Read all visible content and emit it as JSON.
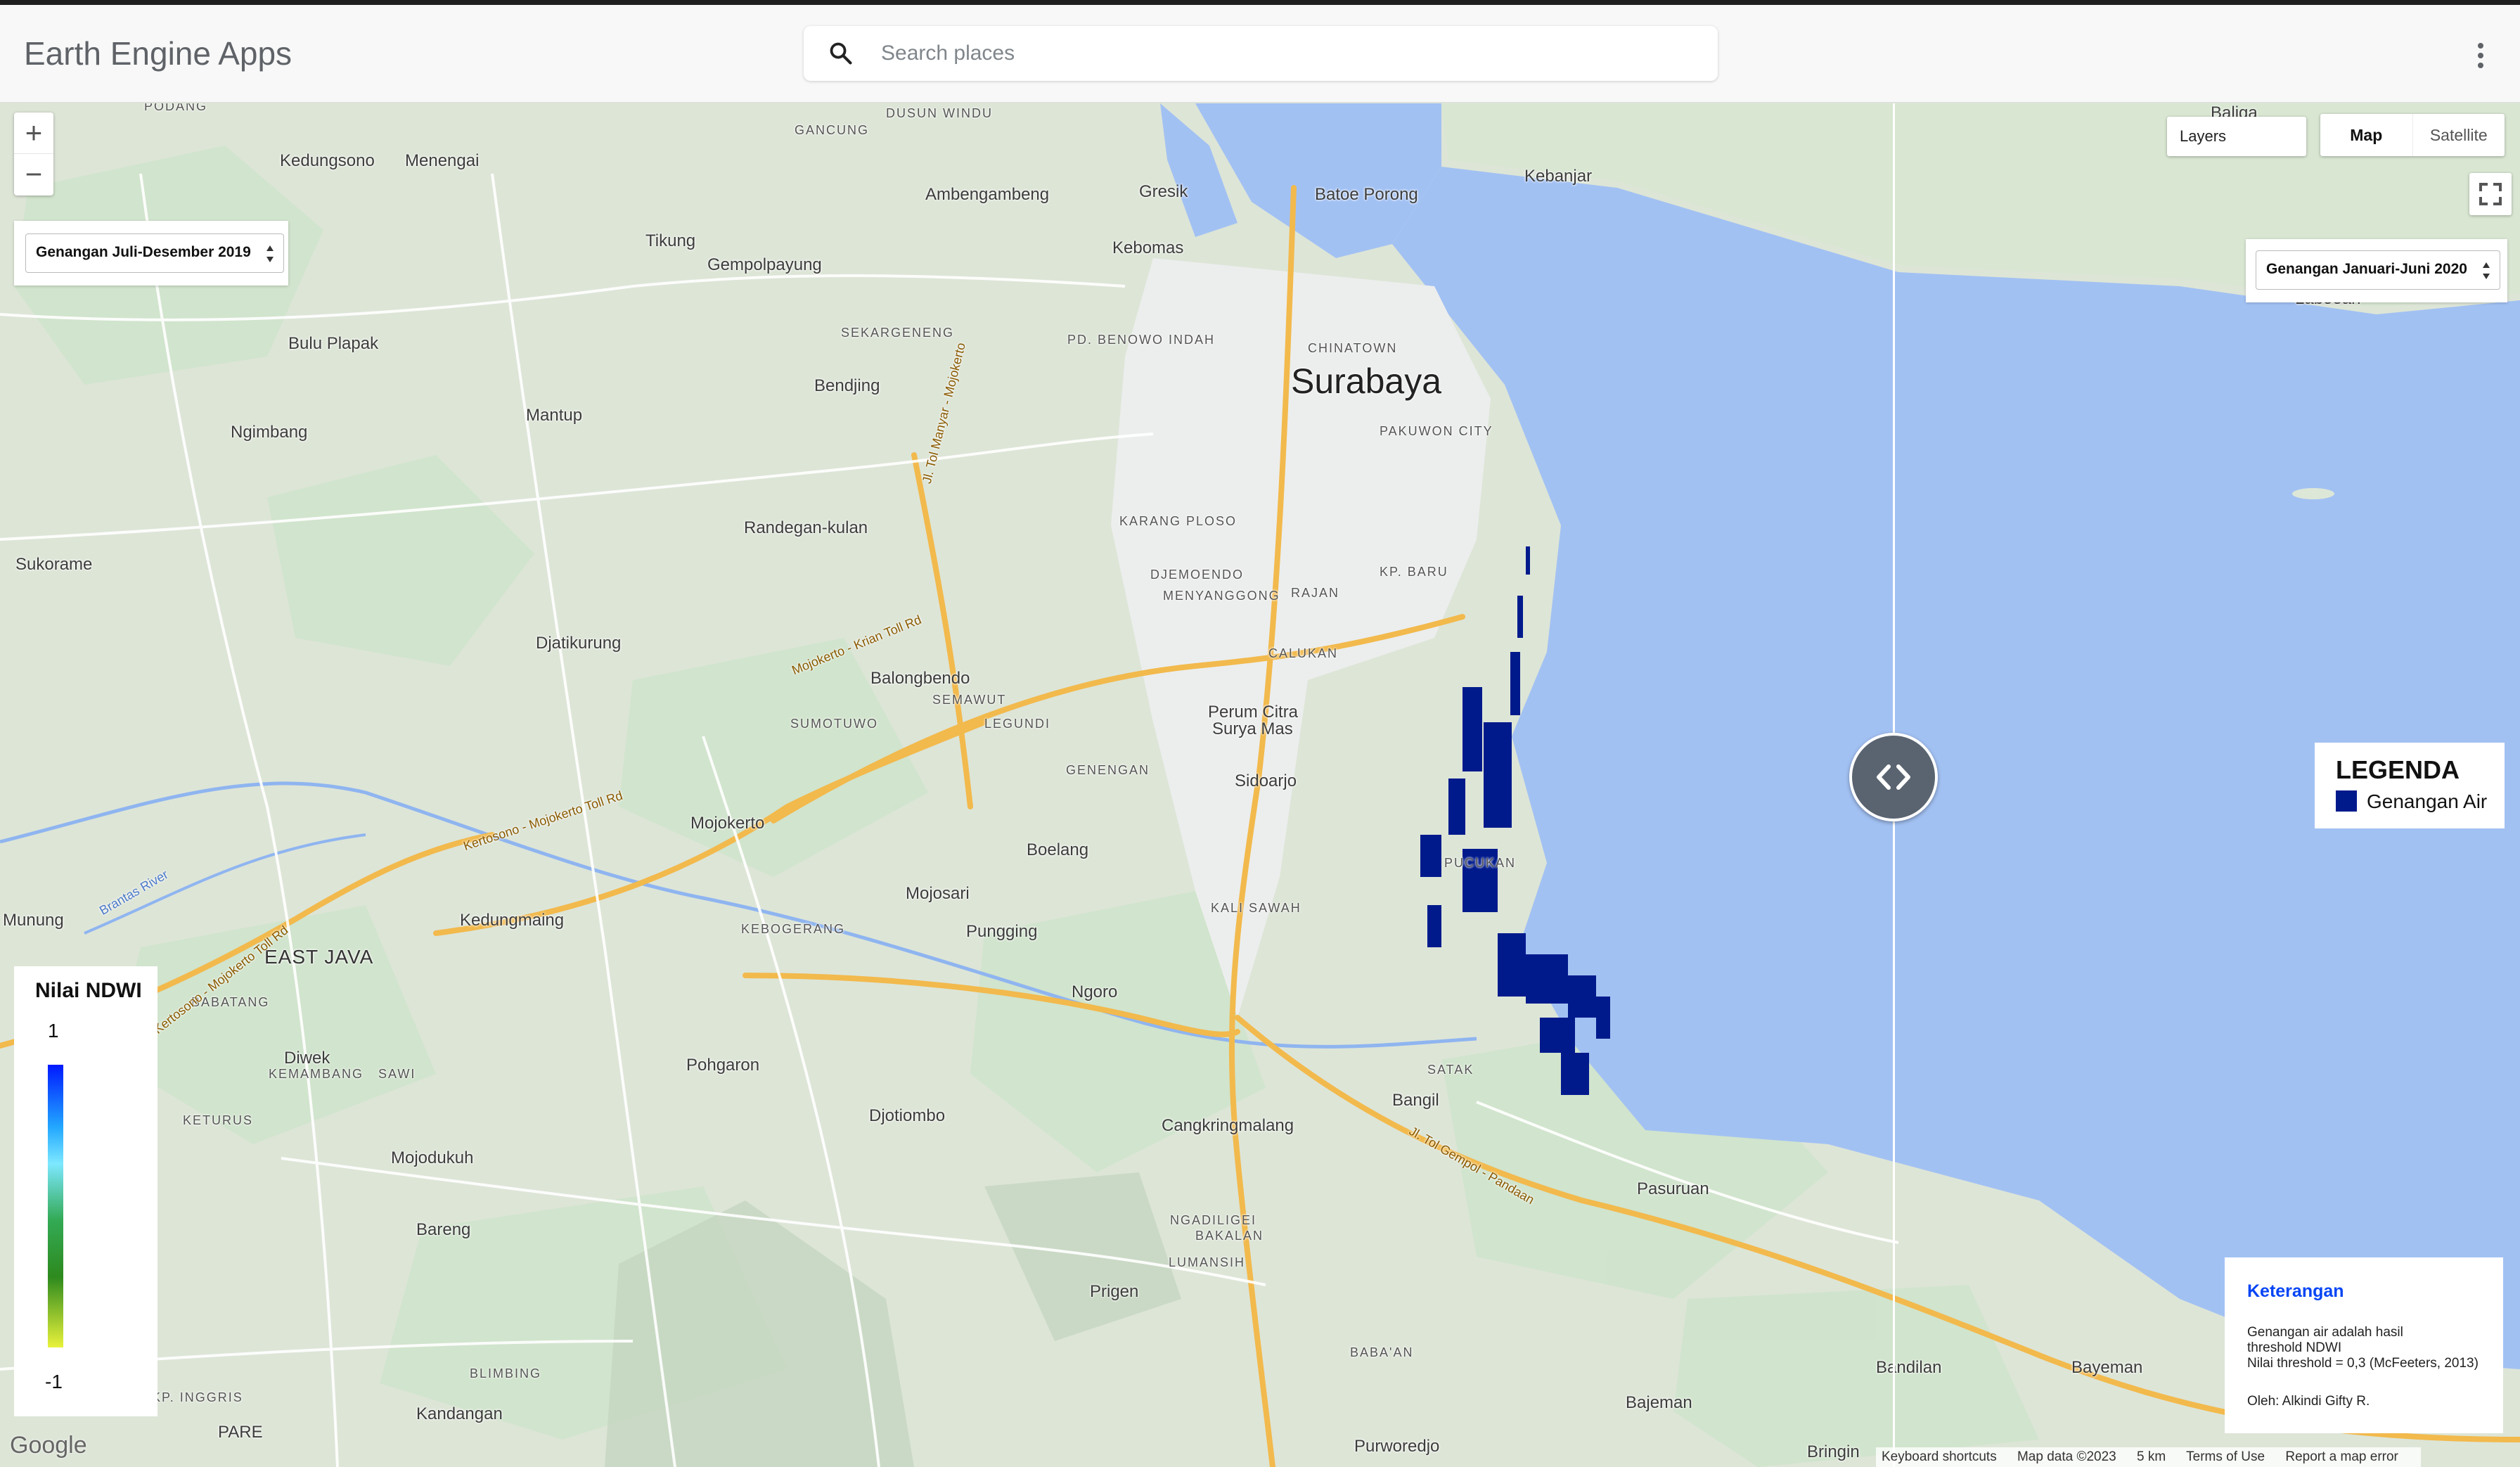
{
  "app": {
    "title": "Earth Engine Apps"
  },
  "search": {
    "placeholder": "Search places",
    "value": ""
  },
  "map_controls": {
    "zoom_in": "+",
    "zoom_out": "−",
    "layers_label": "Layers",
    "map_type_map": "Map",
    "map_type_satellite": "Satellite"
  },
  "left_select": {
    "value": "Genangan Juli-Desember 2019"
  },
  "right_select": {
    "value": "Genangan Januari-Juni 2020"
  },
  "ndwi_legend": {
    "title": "Nilai NDWI",
    "max": "1",
    "min": "-1"
  },
  "legenda": {
    "title": "LEGENDA",
    "item_label": "Genangan Air",
    "item_color": "#001a8c"
  },
  "keterangan": {
    "title": "Keterangan",
    "line1": "Genangan air adalah hasil",
    "line2": "threshold NDWI",
    "line3": "Nilai threshold = 0,3 (McFeeters, 2013)",
    "author": "Oleh: Alkindi Gifty R."
  },
  "attribution": {
    "keyboard": "Keyboard shortcuts",
    "map_data": "Map data ©2023",
    "scale": "5 km",
    "terms": "Terms of Use",
    "report": "Report a map error"
  },
  "map_logo": "Google",
  "places": {
    "podang": "PODANG",
    "kedungsono": "Kedungsono",
    "menengai": "Menengai",
    "gancung": "GANCUNG",
    "dusun_windu": "DUSUN WINDU",
    "ambengambeng": "Ambengambeng",
    "gresik": "Gresik",
    "kebomas": "Kebomas",
    "batoe_porong": "Batoe Porong",
    "kebanjar": "Kebanjar",
    "baliga": "Baliga",
    "laboean": "Laboean",
    "tikung": "Tikung",
    "gempolpayung": "Gempolpayung",
    "bulu_plapak": "Bulu Plapak",
    "sekargeneng": "SEKARGENENG",
    "pd_benowo_indah": "PD. BENOWO INDAH",
    "chinatown": "CHINATOWN",
    "surabaya": "Surabaya",
    "bendjing": "Bendjing",
    "mantup": "Mantup",
    "ngimbang": "Ngimbang",
    "pakuwon_city": "PAKUWON CITY",
    "karang_ploso": "KARANG PLOSO",
    "randegan_kulan": "Randegan-kulan",
    "sukorame": "Sukorame",
    "djemoendo": "DJEMOENDO",
    "kp_baru": "KP. BARU",
    "menyanggong": "MENYANGGONG",
    "rajan": "RAJAN",
    "djatikurung": "Djatikurung",
    "calukan": "CALUKAN",
    "balongbendo": "Balongbendo",
    "semawut": "SEMAWUT",
    "sumotuwo": "SUMOTUWO",
    "legundi": "LEGUNDI",
    "perum_citra_1": "Perum Citra",
    "perum_citra_2": "Surya Mas",
    "geneng": "GENENGAN",
    "sidoarjo": "Sidoarjo",
    "mojokerto": "Mojokerto",
    "boelang": "Boelang",
    "puchkan": "PUCUKAN",
    "mojosari": "Mojosari",
    "kebogerang": "KEBOGERANG",
    "pungging": "Pungging",
    "kali_sawah": "KALI SAWAH",
    "munung": "Munung",
    "kedungmaing": "Kedungmaing",
    "east_java": "EAST JAVA",
    "babatang": "BABATANG",
    "ngoro": "Ngoro",
    "diwek": "Diwek",
    "kemambang": "KEMAMBANG",
    "sawi": "SAWI",
    "pohgaron": "Pohgaron",
    "satak": "SATAK",
    "bangil": "Bangil",
    "keturus": "KETURUS",
    "djotiombo": "Djotiombo",
    "cangkringmalang": "Cangkringmalang",
    "mojodukuh": "Mojodukuh",
    "pasuruan": "Pasuruan",
    "bareng": "Bareng",
    "ngadiligei": "NGADILIGEI",
    "bakalan": "BAKALAN",
    "lumansih": "LUMANSIH",
    "prigen": "Prigen",
    "baba_an": "BABA'AN",
    "blimbing": "BLIMBING",
    "bandilan": "Bandilan",
    "bayeman": "Bayeman",
    "kp_inggris": "KP. INGGRIS",
    "pare": "PARE",
    "kandangan": "Kandangan",
    "bajeman": "Bajeman",
    "purworedjo": "Purworedjo",
    "bringin": "Bringin",
    "road_mojokerto_krian": "Mojokerto - Krian Toll Rd",
    "road_manyar": "Jl. Tol Manyar - Mojokerto",
    "road_kertosono": "Kertosono - Mojokerto Toll Rd",
    "road_gempol": "Jl. Tol Gempol - Pandaan",
    "road_brantas": "Brantas River",
    "road_kertosono2": "Kertosono - Mojokerto Toll Rd"
  }
}
